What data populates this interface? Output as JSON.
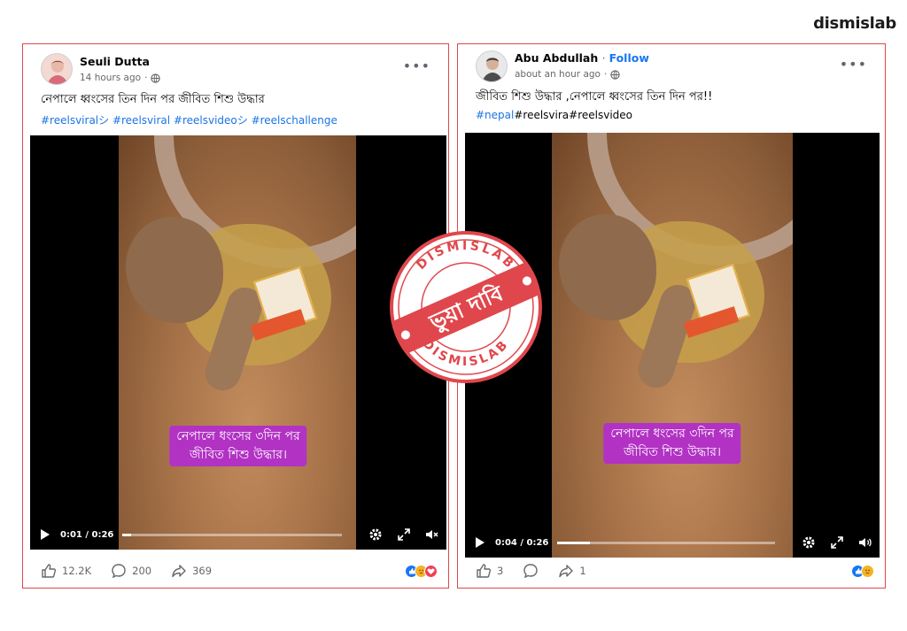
{
  "brand": {
    "name": "dismislab"
  },
  "posts": [
    {
      "author": "Seuli Dutta",
      "follow": "",
      "time": "14 hours ago",
      "caption": "নেপালে ধ্বংসের তিন দিন পর জীবিত শিশু উদ্ধার",
      "tags": "#reelsviralシ #reelsviral #reelsvideoシ #reelschallenge",
      "subtitle": [
        "নেপালে ধংসের ৩দিন পর",
        "জীবিত শিশু উদ্ধার।"
      ],
      "video": {
        "time": "0:01 / 0:26",
        "progress": 0.04,
        "muted": true
      },
      "actions": {
        "likes": "12.2K",
        "comments": "200",
        "shares": "369"
      },
      "reactions": [
        "like-icon",
        "sad-icon",
        "love-icon"
      ]
    },
    {
      "author": "Abu Abdullah",
      "follow": "Follow",
      "time": "about an hour ago",
      "caption": "জীবিত শিশু উদ্ধার ,নেপালে ধ্বংসের তিন দিন পর!!",
      "tags_hashtag": "#nepal",
      "tags_rest": "#reelsvira#reelsvideo",
      "subtitle": [
        "নেপালে ধংসের ৩দিন পর",
        "জীবিত শিশু উদ্ধার।"
      ],
      "video": {
        "time": "0:04 / 0:26",
        "progress": 0.15,
        "muted": false
      },
      "actions": {
        "likes": "3",
        "comments": "",
        "shares": "1"
      },
      "reactions": [
        "like-icon",
        "sad-icon"
      ]
    }
  ],
  "stamp": {
    "ring_text": "DISMISLAB",
    "banner": "ভুয়া দাবি"
  },
  "colors": {
    "stamp_red": "#e0474c",
    "facebook_blue": "#1877f2",
    "subtitle_purple": "#b232c4",
    "border_red": "#e0474c"
  }
}
